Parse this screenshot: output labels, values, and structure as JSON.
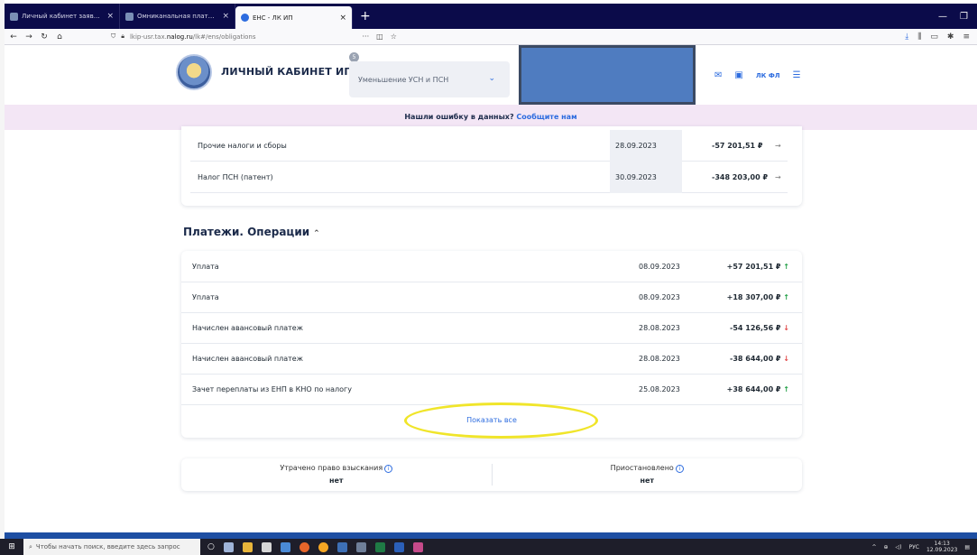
{
  "browser": {
    "tabs": [
      {
        "label": "Личный кабинет заявителя",
        "active": false
      },
      {
        "label": "Омниканальная платформа",
        "active": false
      },
      {
        "label": "ЕНС - ЛК ИП",
        "active": true
      }
    ],
    "url_prefix": "lkip-usr.tax.",
    "url_domain": "nalog.ru",
    "url_path": "/lk#/ens/obligations",
    "url_menu": "···"
  },
  "header": {
    "brand": "ЛИЧНЫЙ КАБИНЕТ ИП",
    "badge": "5",
    "mode_select": "Уменьшение УСН и ПСН",
    "profile_short": "ЛК ФЛ"
  },
  "banner": {
    "text": "Нашли ошибку в данных?",
    "link": "Сообщите нам"
  },
  "taxes": [
    {
      "name": "Прочие налоги и сборы",
      "date": "28.09.2023",
      "amount": "-57 201,51 ₽"
    },
    {
      "name": "Налог ПСН (патент)",
      "date": "30.09.2023",
      "amount": "-348 203,00 ₽"
    }
  ],
  "payments": {
    "title": "Платежи. Операции",
    "rows": [
      {
        "name": "Уплата",
        "date": "08.09.2023",
        "amount": "+57 201,51 ₽",
        "direction": "up"
      },
      {
        "name": "Уплата",
        "date": "08.09.2023",
        "amount": "+18 307,00 ₽",
        "direction": "up"
      },
      {
        "name": "Начислен авансовый платеж",
        "date": "28.08.2023",
        "amount": "-54 126,56 ₽",
        "direction": "down"
      },
      {
        "name": "Начислен авансовый платеж",
        "date": "28.08.2023",
        "amount": "-38 644,00 ₽",
        "direction": "down"
      },
      {
        "name": "Зачет переплаты из ЕНП в КНО по налогу",
        "date": "25.08.2023",
        "amount": "+38 644,00 ₽",
        "direction": "up"
      }
    ],
    "show_all": "Показать все"
  },
  "stats": [
    {
      "label": "Утрачено право взыскания",
      "value": "нет"
    },
    {
      "label": "Приостановлено",
      "value": "нет"
    }
  ],
  "taskbar": {
    "search_placeholder": "Чтобы начать поиск, введите здесь запрос",
    "lang": "РУС",
    "time": "14:13",
    "date": "12.09.2023"
  },
  "colors": {
    "accent": "#2d6cdf",
    "up": "#23a047",
    "down": "#e04848",
    "banner_bg": "#f3e6f5",
    "highlight": "#f0e52a"
  }
}
